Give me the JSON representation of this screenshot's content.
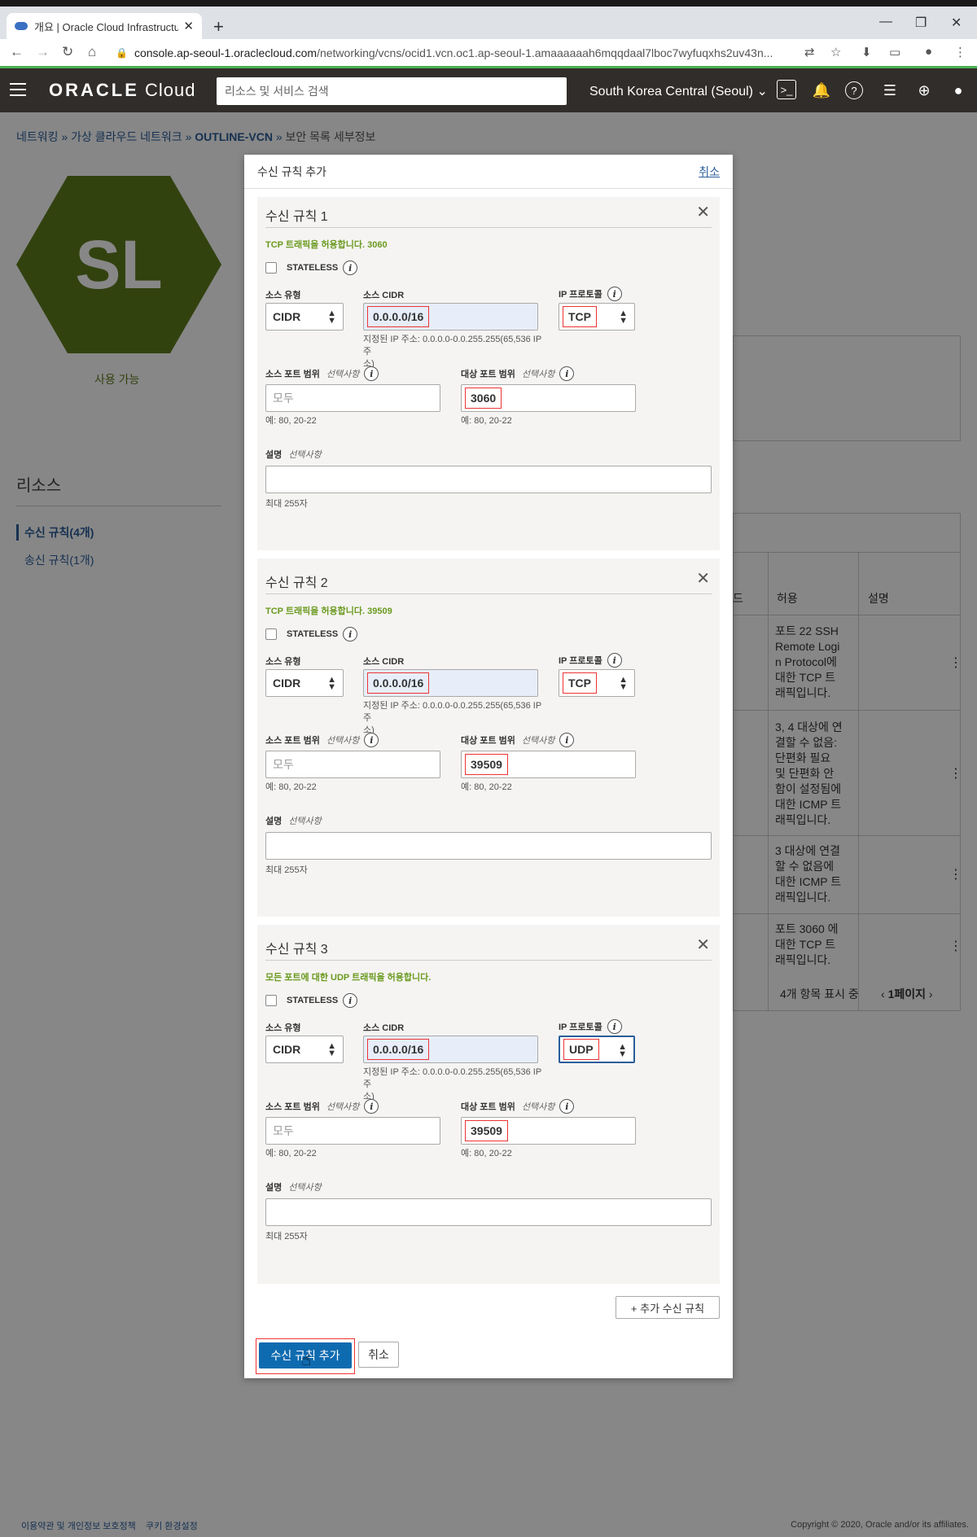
{
  "browser": {
    "tab_title": "개요 | Oracle Cloud Infrastructu",
    "url_host": "console.ap-seoul-1.oraclecloud.com",
    "url_path": "/networking/vcns/ocid1.vcn.oc1.ap-seoul-1.amaaaaaah6mqqdaal7lboc7wyfuqxhs2uv43n..."
  },
  "header": {
    "logo_text": "ORACLE",
    "logo_sub": "Cloud",
    "search_placeholder": "리소스 및 서비스 검색",
    "region": "South Korea Central (Seoul)"
  },
  "breadcrumb": {
    "item1": "네트워킹",
    "item2": "가상 클라우드 네트워크",
    "item3": "OUTLINE-VCN",
    "current": "보안 목록 세부정보",
    "sep": "»"
  },
  "resource": {
    "badge": "SL",
    "status": "사용 가능",
    "section_title": "리소스",
    "ingress_link": "수신 규칙(4개)",
    "egress_link": "송신 규칙(1개)"
  },
  "bg_table": {
    "col_d": "드",
    "col_allow": "허용",
    "col_desc": "설명",
    "rows": [
      [
        "포트 22 SSH",
        "Remote Logi",
        "n Protocol에",
        "대한 TCP 트",
        "래픽입니다."
      ],
      [
        "3, 4 대상에 연",
        "결할 수 없음:",
        "단편화 필요",
        "및 단편화 안",
        "함이 설정됨에",
        "대한 ICMP 트",
        "래픽입니다."
      ],
      [
        "3 대상에 연결",
        "할 수 없음에",
        "대한 ICMP 트",
        "래픽입니다."
      ],
      [
        "포트 3060 에",
        "대한 TCP 트",
        "래픽입니다."
      ]
    ],
    "paging": "4개 항목 표시 중",
    "page": "1페이지"
  },
  "modal": {
    "title": "수신 규칙 추가",
    "cancel_link": "취소",
    "labels": {
      "stateless": "STATELESS",
      "source_type": "소스 유형",
      "source_cidr": "소스 CIDR",
      "ip_protocol": "IP 프로토콜",
      "source_port": "소스 포트 범위",
      "dest_port": "대상 포트 범위",
      "optional": "선택사항",
      "description": "설명",
      "max_len": "최대 255자",
      "port_example": "예: 80, 20-22",
      "cidr_hint_a": "지정된 IP 주소: 0.0.0.0-0.0.255.255(65,536 IP 주",
      "cidr_hint_b": "소)",
      "source_port_placeholder": "모두"
    },
    "rules": [
      {
        "title": "수신 규칙 1",
        "summary": "TCP 트래픽을 허용합니다. 3060",
        "source_type": "CIDR",
        "source_cidr": "0.0.0.0/16",
        "ip_protocol": "TCP",
        "dest_port": "3060"
      },
      {
        "title": "수신 규칙 2",
        "summary": "TCP 트래픽을 허용합니다. 39509",
        "source_type": "CIDR",
        "source_cidr": "0.0.0.0/16",
        "ip_protocol": "TCP",
        "dest_port": "39509"
      },
      {
        "title": "수신 규칙 3",
        "summary": "모든 포트에 대한 UDP 트래픽을 허용합니다.",
        "source_type": "CIDR",
        "source_cidr": "0.0.0.0/16",
        "ip_protocol": "UDP",
        "dest_port": "39509"
      }
    ],
    "add_rule_button": "+ 추가 수신 규칙",
    "submit_button": "수신 규칙 추가",
    "cancel_button": "취소"
  },
  "footer": {
    "left1": "이용약관 및 개인정보 보호정책",
    "left2": "쿠키 환경설정",
    "right": "Copyright © 2020, Oracle and/or its affiliates."
  }
}
